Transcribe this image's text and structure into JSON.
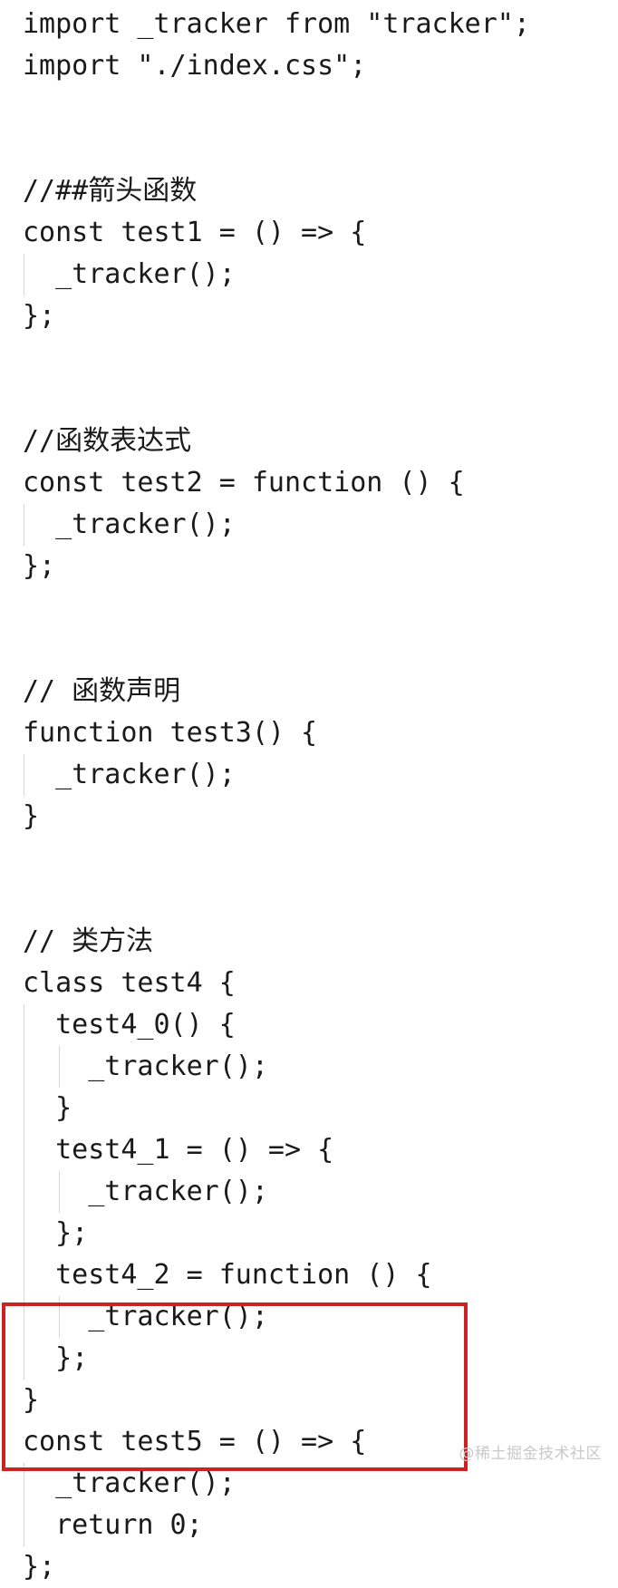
{
  "editor": {
    "language": "javascript",
    "background_color": "#ffffff",
    "text_color": "#1a1a1a",
    "indent_guide_color": "#d6d6d6",
    "font_size_px": 30,
    "line_height_px": 46,
    "lines": [
      {
        "n": 1,
        "text": "import _tracker from \"tracker\";",
        "indent": 0,
        "guides": 0
      },
      {
        "n": 2,
        "text": "import \"./index.css\";",
        "indent": 0,
        "guides": 0
      },
      {
        "n": 3,
        "text": "",
        "indent": 0,
        "guides": 0
      },
      {
        "n": 4,
        "text": "",
        "indent": 0,
        "guides": 0
      },
      {
        "n": 5,
        "text": "//##箭头函数",
        "indent": 0,
        "guides": 0
      },
      {
        "n": 6,
        "text": "const test1 = () => {",
        "indent": 0,
        "guides": 0
      },
      {
        "n": 7,
        "text": "  _tracker();",
        "indent": 1,
        "guides": 1
      },
      {
        "n": 8,
        "text": "};",
        "indent": 0,
        "guides": 0
      },
      {
        "n": 9,
        "text": "",
        "indent": 0,
        "guides": 0
      },
      {
        "n": 10,
        "text": "",
        "indent": 0,
        "guides": 0
      },
      {
        "n": 11,
        "text": "//函数表达式",
        "indent": 0,
        "guides": 0
      },
      {
        "n": 12,
        "text": "const test2 = function () {",
        "indent": 0,
        "guides": 0
      },
      {
        "n": 13,
        "text": "  _tracker();",
        "indent": 1,
        "guides": 1
      },
      {
        "n": 14,
        "text": "};",
        "indent": 0,
        "guides": 0
      },
      {
        "n": 15,
        "text": "",
        "indent": 0,
        "guides": 0
      },
      {
        "n": 16,
        "text": "",
        "indent": 0,
        "guides": 0
      },
      {
        "n": 17,
        "text": "// 函数声明",
        "indent": 0,
        "guides": 0
      },
      {
        "n": 18,
        "text": "function test3() {",
        "indent": 0,
        "guides": 0
      },
      {
        "n": 19,
        "text": "  _tracker();",
        "indent": 1,
        "guides": 1
      },
      {
        "n": 20,
        "text": "}",
        "indent": 0,
        "guides": 0
      },
      {
        "n": 21,
        "text": "",
        "indent": 0,
        "guides": 0
      },
      {
        "n": 22,
        "text": "",
        "indent": 0,
        "guides": 0
      },
      {
        "n": 23,
        "text": "// 类方法",
        "indent": 0,
        "guides": 0
      },
      {
        "n": 24,
        "text": "class test4 {",
        "indent": 0,
        "guides": 0
      },
      {
        "n": 25,
        "text": "  test4_0() {",
        "indent": 1,
        "guides": 1
      },
      {
        "n": 26,
        "text": "    _tracker();",
        "indent": 2,
        "guides": 2
      },
      {
        "n": 27,
        "text": "  }",
        "indent": 1,
        "guides": 1
      },
      {
        "n": 28,
        "text": "  test4_1 = () => {",
        "indent": 1,
        "guides": 1
      },
      {
        "n": 29,
        "text": "    _tracker();",
        "indent": 2,
        "guides": 2
      },
      {
        "n": 30,
        "text": "  };",
        "indent": 1,
        "guides": 1
      },
      {
        "n": 31,
        "text": "  test4_2 = function () {",
        "indent": 1,
        "guides": 1
      },
      {
        "n": 32,
        "text": "    _tracker();",
        "indent": 2,
        "guides": 2
      },
      {
        "n": 33,
        "text": "  };",
        "indent": 1,
        "guides": 1
      },
      {
        "n": 34,
        "text": "}",
        "indent": 0,
        "guides": 0
      },
      {
        "n": 35,
        "text": "const test5 = () => {",
        "indent": 0,
        "guides": 0
      },
      {
        "n": 36,
        "text": "  _tracker();",
        "indent": 1,
        "guides": 1
      },
      {
        "n": 37,
        "text": "  return 0;",
        "indent": 1,
        "guides": 1
      },
      {
        "n": 38,
        "text": "};",
        "indent": 0,
        "guides": 0
      }
    ]
  },
  "annotation": {
    "type": "rectangle-highlight",
    "color": "#cc2222",
    "covers_lines": [
      35,
      36,
      37,
      38
    ],
    "label": ""
  },
  "watermark": {
    "text": "@稀土掘金技术社区",
    "color": "#c9c9c9"
  }
}
